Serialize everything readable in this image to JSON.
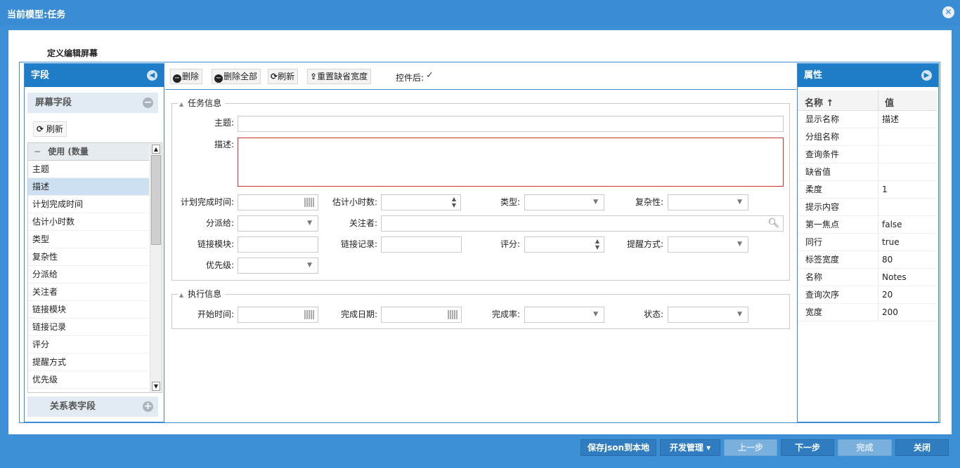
{
  "window": {
    "title": "当前模型:任务",
    "close_glyph": "✕"
  },
  "section_title": "定义编辑屏幕",
  "left_panel": {
    "title": "字段",
    "screen_fields": {
      "title": "屏幕字段",
      "refresh_label": "刷新"
    },
    "list_header": "使用 (数量",
    "items": [
      "主题",
      "描述",
      "计划完成时间",
      "估计小时数",
      "类型",
      "复杂性",
      "分派给",
      "关注者",
      "链接模块",
      "链接记录",
      "评分",
      "提醒方式",
      "优先级"
    ],
    "selected_item": "描述",
    "relation_fields": {
      "title": "关系表字段"
    }
  },
  "toolbar": {
    "delete_label": "删除",
    "delete_all_label": "删除全部",
    "refresh_label": "刷新",
    "reset_width_label": "重置缺省宽度",
    "after_control_label": "控件后:",
    "after_control_checked": true
  },
  "task_info": {
    "legend": "任务信息",
    "subject_label": "主题:",
    "desc_label": "描述:",
    "plan_time_label": "计划完成时间:",
    "est_hours_label": "估计小时数:",
    "type_label": "类型:",
    "complexity_label": "复杂性:",
    "assign_label": "分派给:",
    "follower_label": "关注者:",
    "link_module_label": "链接模块:",
    "link_record_label": "链接记录:",
    "rating_label": "评分:",
    "remind_label": "提醒方式:",
    "priority_label": "优先级:"
  },
  "exec_info": {
    "legend": "执行信息",
    "start_label": "开始时间:",
    "done_date_label": "完成日期:",
    "done_rate_label": "完成率:",
    "status_label": "状态:"
  },
  "right_panel": {
    "title": "属性",
    "col_name": "名称 ↑",
    "col_value": "值",
    "rows": [
      {
        "name": "显示名称",
        "value": "描述"
      },
      {
        "name": "分组名称",
        "value": ""
      },
      {
        "name": "查询条件",
        "value": ""
      },
      {
        "name": "缺省值",
        "value": ""
      },
      {
        "name": "柔度",
        "value": "1"
      },
      {
        "name": "提示内容",
        "value": ""
      },
      {
        "name": "第一焦点",
        "value": "false"
      },
      {
        "name": "同行",
        "value": "true"
      },
      {
        "name": "标签宽度",
        "value": "80"
      },
      {
        "name": "名称",
        "value": "Notes"
      },
      {
        "name": "查询次序",
        "value": "20"
      },
      {
        "name": "宽度",
        "value": "200"
      }
    ]
  },
  "footer": {
    "save_json_label": "保存json到本地",
    "dev_manage_label": "开发管理 ▾",
    "prev_label": "上一步",
    "next_label": "下一步",
    "finish_label": "完成",
    "close_label": "关闭"
  },
  "colors": {
    "accent": "#1f7cc7",
    "frame": "#3a8cd4",
    "error_border": "#cc3333"
  }
}
